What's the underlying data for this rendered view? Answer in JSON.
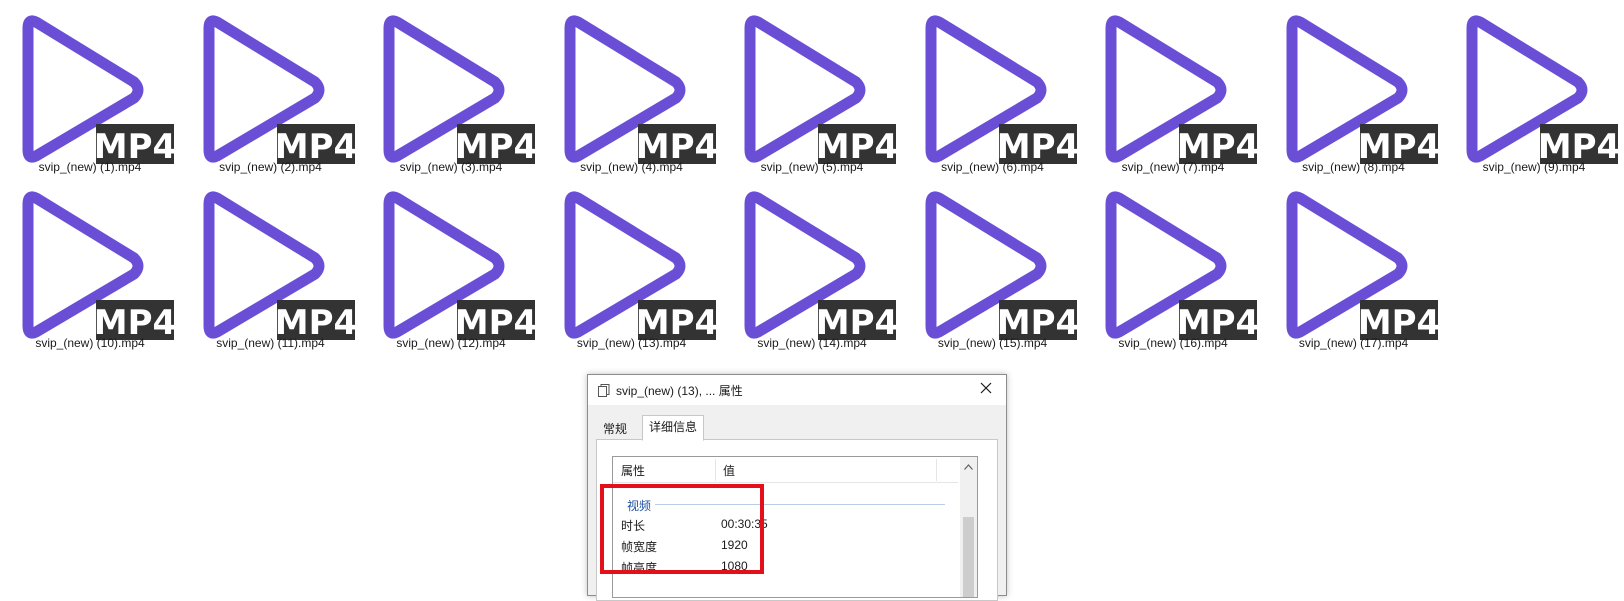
{
  "files": [
    {
      "name": "svip_(new) (1).mp4",
      "badge": "MP4"
    },
    {
      "name": "svip_(new) (2).mp4",
      "badge": "MP4"
    },
    {
      "name": "svip_(new) (3).mp4",
      "badge": "MP4"
    },
    {
      "name": "svip_(new) (4).mp4",
      "badge": "MP4"
    },
    {
      "name": "svip_(new) (5).mp4",
      "badge": "MP4"
    },
    {
      "name": "svip_(new) (6).mp4",
      "badge": "MP4"
    },
    {
      "name": "svip_(new) (7).mp4",
      "badge": "MP4"
    },
    {
      "name": "svip_(new) (8).mp4",
      "badge": "MP4"
    },
    {
      "name": "svip_(new) (9).mp4",
      "badge": "MP4"
    },
    {
      "name": "svip_(new) (10).mp4",
      "badge": "MP4"
    },
    {
      "name": "svip_(new) (11).mp4",
      "badge": "MP4"
    },
    {
      "name": "svip_(new) (12).mp4",
      "badge": "MP4"
    },
    {
      "name": "svip_(new) (13).mp4",
      "badge": "MP4"
    },
    {
      "name": "svip_(new) (14).mp4",
      "badge": "MP4"
    },
    {
      "name": "svip_(new) (15).mp4",
      "badge": "MP4"
    },
    {
      "name": "svip_(new) (16).mp4",
      "badge": "MP4"
    },
    {
      "name": "svip_(new) (17).mp4",
      "badge": "MP4"
    }
  ],
  "colors": {
    "play_icon": "#6a4fd6",
    "badge_bg": "#333333",
    "badge_text": "#ffffff",
    "highlight": "#e3101c",
    "group_text": "#1e50a0"
  },
  "icons": {
    "file": "play-triangle-icon",
    "title": "document-icon",
    "close": "close-icon",
    "scroll_up": "chevron-up-icon"
  },
  "dialog": {
    "title": "svip_(new) (13), ... 属性",
    "tabs": [
      {
        "label": "常规",
        "active": false
      },
      {
        "label": "详细信息",
        "active": true
      }
    ],
    "columns": {
      "property": "属性",
      "value": "值"
    },
    "group": "视频",
    "rows": [
      {
        "key": "时长",
        "value": "00:30:35"
      },
      {
        "key": "帧宽度",
        "value": "1920"
      },
      {
        "key": "帧高度",
        "value": "1080"
      }
    ]
  }
}
